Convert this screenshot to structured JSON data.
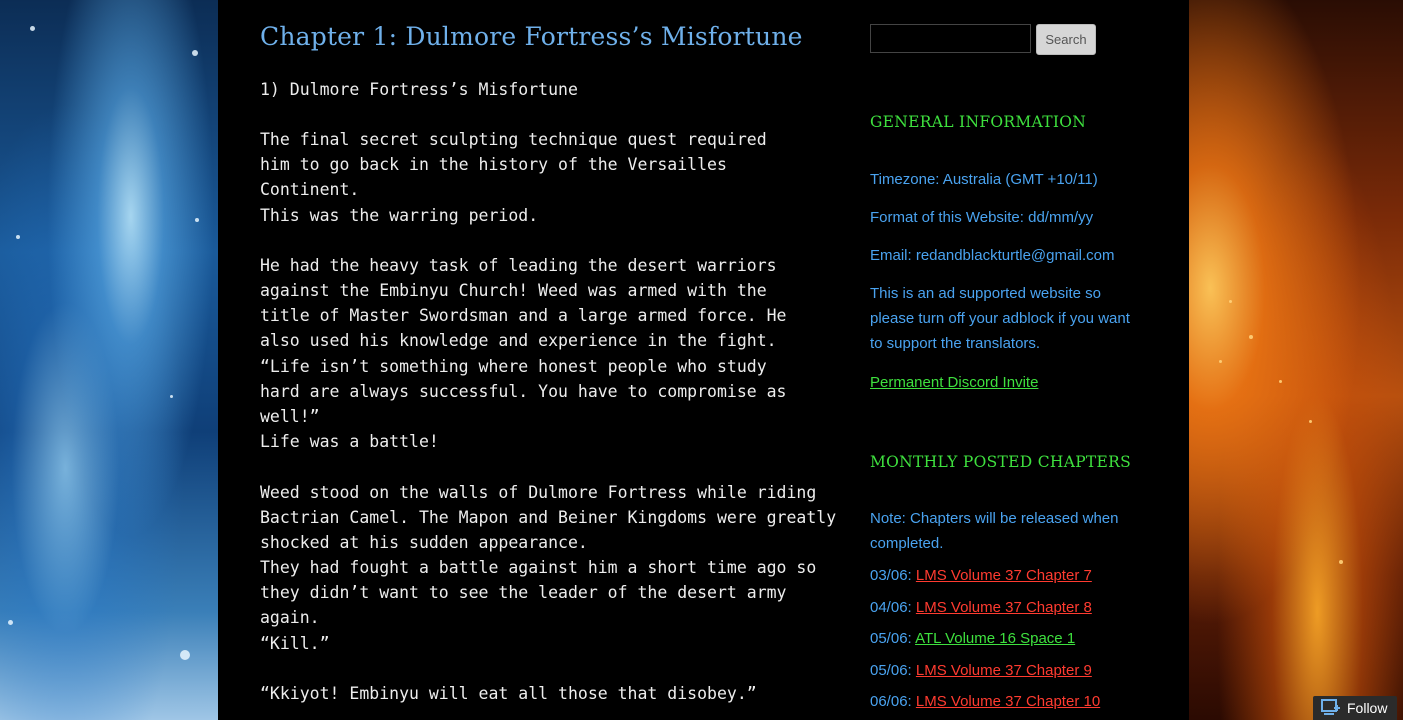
{
  "chapter": {
    "title": "Chapter 1: Dulmore Fortress’s Misfortune",
    "paragraphs": [
      "1) Dulmore Fortress’s Misfortune",
      "The final secret sculpting technique quest required him to go back in the history of the Versailles Continent.",
      "This was the warring period.",
      "He had the heavy task of leading the desert warriors against the Embinyu Church! Weed was armed with the title of Master Swordsman and a large armed force. He also used his knowledge and experience in the fight.",
      "“Life isn’t something where honest people who study hard are always successful. You have to compromise as well!”",
      "Life was a battle!",
      "Weed stood on the walls of Dulmore Fortress while riding Bactrian Camel. The Mapon and Beiner Kingdoms were greatly shocked at his sudden appearance.",
      "They had fought a battle against him a short time ago so they didn’t want to see the leader of the desert army again.",
      "“Kill.”",
      "“Kkiyot! Embinyu will eat all those that disobey.”"
    ]
  },
  "sidebar": {
    "search_button": "Search",
    "general_info": {
      "heading": "General Information",
      "timezone": "Timezone: Australia (GMT +10/11)",
      "format": "Format of this Website: dd/mm/yy",
      "email": "Email: redandblackturtle@gmail.com",
      "adblock": "This is an ad supported website so please turn off your adblock if you want to support the translators.",
      "discord": "Permanent Discord Invite"
    },
    "monthly": {
      "heading": "Monthly Posted Chapters",
      "note": "Note: Chapters will be released when completed.",
      "entries": [
        {
          "date": "03/06:",
          "title": "LMS Volume 37 Chapter 7",
          "color": "red"
        },
        {
          "date": "04/06:",
          "title": "LMS Volume 37 Chapter 8",
          "color": "red"
        },
        {
          "date": "05/06:",
          "title": "ATL Volume 16 Space 1",
          "color": "green"
        },
        {
          "date": "05/06:",
          "title": "LMS Volume 37 Chapter 9",
          "color": "red"
        },
        {
          "date": "06/06:",
          "title": "LMS Volume 37 Chapter 10",
          "color": "red"
        }
      ]
    }
  },
  "follow_button": "Follow",
  "colors": {
    "title_blue": "#6fb0ea",
    "sidebar_blue": "#4aa3f0",
    "heading_green": "#3ee03e",
    "link_red": "#ff3b30"
  }
}
